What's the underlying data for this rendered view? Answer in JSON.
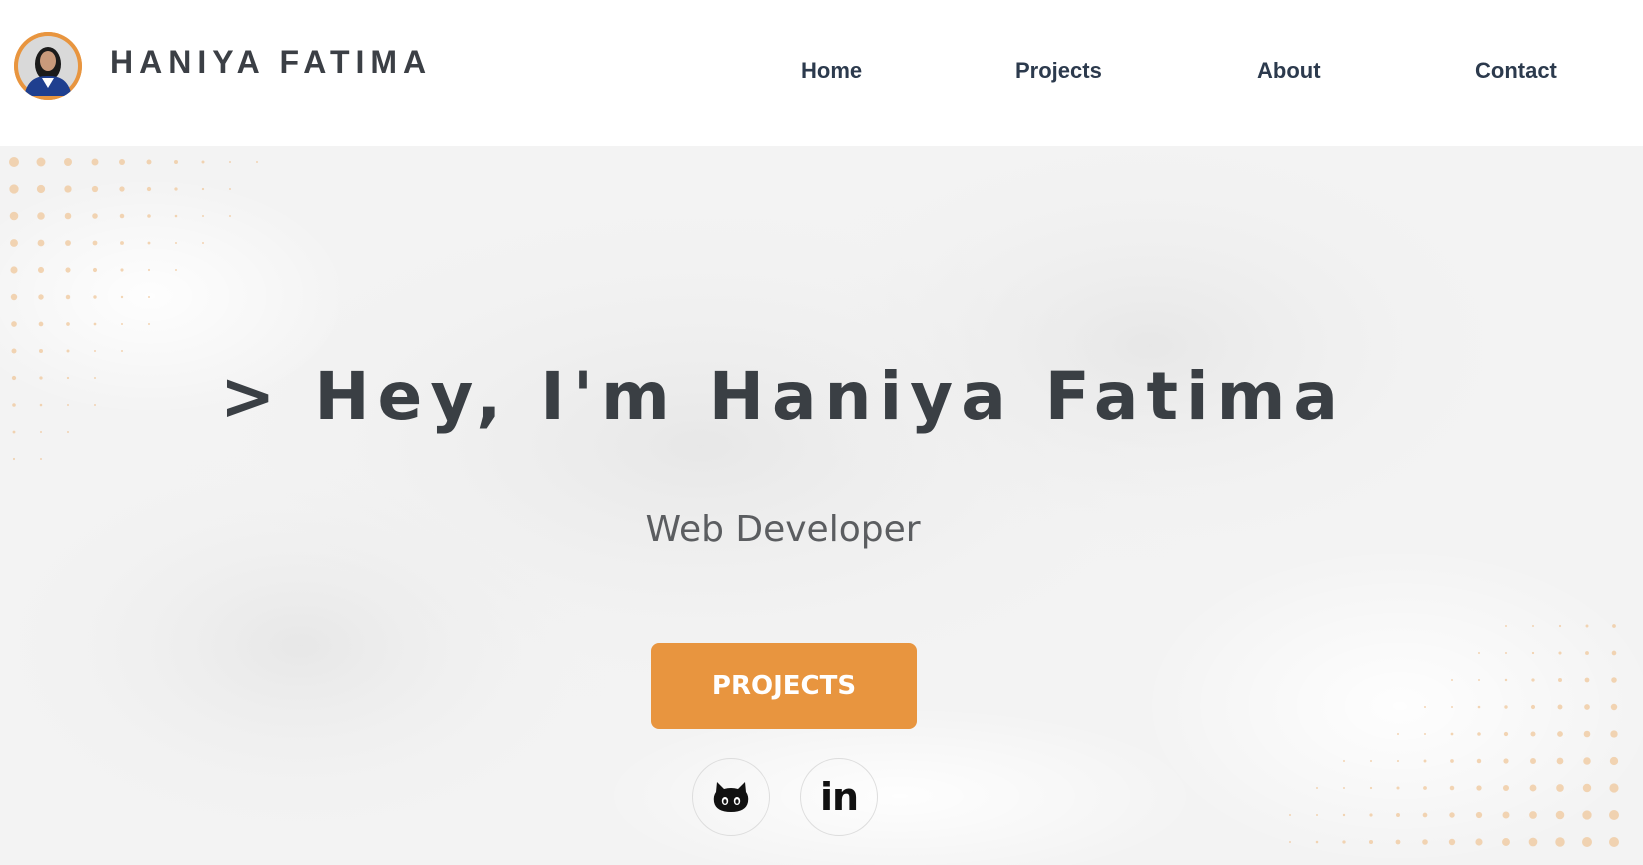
{
  "header": {
    "brand": "HANIYA FATIMA",
    "nav": [
      {
        "label": "Home"
      },
      {
        "label": "Projects"
      },
      {
        "label": "About"
      },
      {
        "label": "Contact"
      }
    ]
  },
  "hero": {
    "headline": "> Hey, I'm Haniya Fatima",
    "subtitle": "Web Developer",
    "cta_label": "PROJECTS",
    "social": [
      {
        "icon": "github-icon"
      },
      {
        "icon": "linkedin-icon",
        "text": "in"
      }
    ]
  },
  "colors": {
    "accent": "#e8953f",
    "heading": "#3a3f44",
    "nav": "#2c3a4d",
    "background": "#f2f2f2"
  }
}
